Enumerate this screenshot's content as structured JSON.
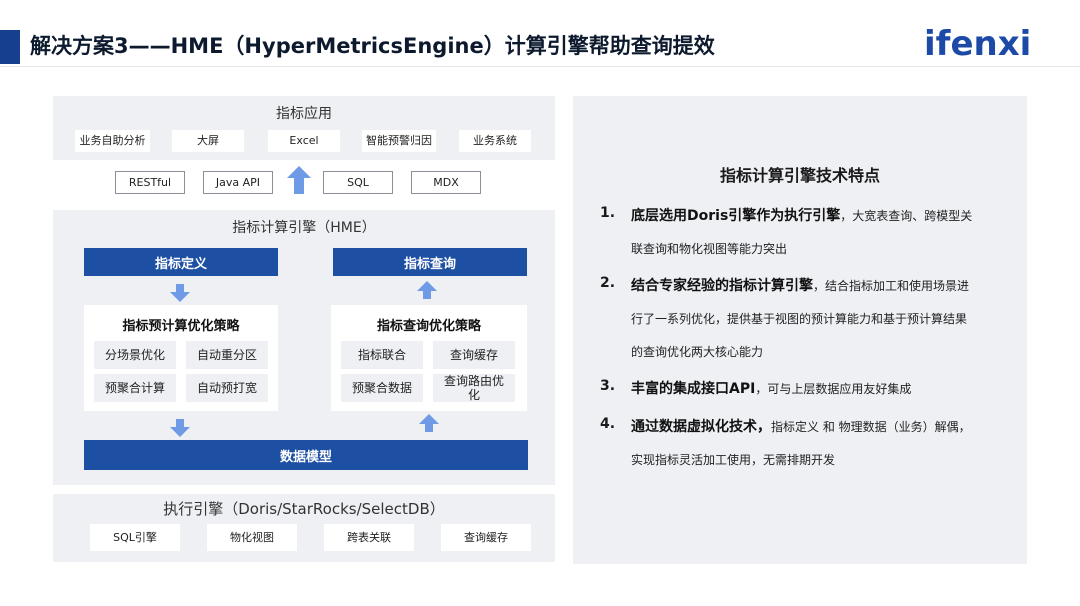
{
  "header": {
    "title": "解决方案3——HME（HyperMetricsEngine）计算引擎帮助查询提效",
    "logo": "ifenxi"
  },
  "apps": {
    "title": "指标应用",
    "items": [
      "业务自助分析",
      "大屏",
      "Excel",
      "智能预警归因",
      "业务系统"
    ]
  },
  "interfaces": [
    "RESTful",
    "Java API",
    "SQL",
    "MDX"
  ],
  "hme": {
    "title": "指标计算引擎（HME）",
    "definition_label": "指标定义",
    "query_label": "指标查询",
    "precompute": {
      "title": "指标预计算优化策略",
      "items": [
        "分场景优化",
        "自动重分区",
        "预聚合计算",
        "自动预打宽"
      ]
    },
    "query_opt": {
      "title": "指标查询优化策略",
      "items": [
        "指标联合",
        "查询缓存",
        "预聚合数据",
        "查询路由优化"
      ]
    },
    "data_model_label": "数据模型"
  },
  "exec": {
    "title": "执行引擎（Doris/StarRocks/SelectDB）",
    "items": [
      "SQL引擎",
      "物化视图",
      "跨表关联",
      "查询缓存"
    ]
  },
  "features": {
    "title": "指标计算引擎技术特点",
    "list": [
      {
        "num": "1.",
        "bold": "底层选用Doris引擎作为执行引擎",
        "text1": "，大宽表查询、跨模型关",
        "text2": "联查询和物化视图等能力突出"
      },
      {
        "num": "2.",
        "bold": "结合专家经验的指标计算引擎",
        "text1": "，结合指标加工和使用场景进",
        "text2": "行了一系列优化，提供基于视图的预计算能力和基于预计算结果",
        "text3": "的查询优化两大核心能力"
      },
      {
        "num": "3.",
        "bold": "丰富的集成接口API",
        "text1": "，可与上层数据应用友好集成"
      },
      {
        "num": "4.",
        "bold": "通过数据虚拟化技术，",
        "text1": "指标定义 和 物理数据（业务）解偶，",
        "text2": "实现指标灵活加工使用，无需排期开发"
      }
    ]
  },
  "colors": {
    "brand_blue": "#1d4fa3",
    "arrow_blue": "#6f9be6",
    "panel_gray": "#eef0f4"
  }
}
